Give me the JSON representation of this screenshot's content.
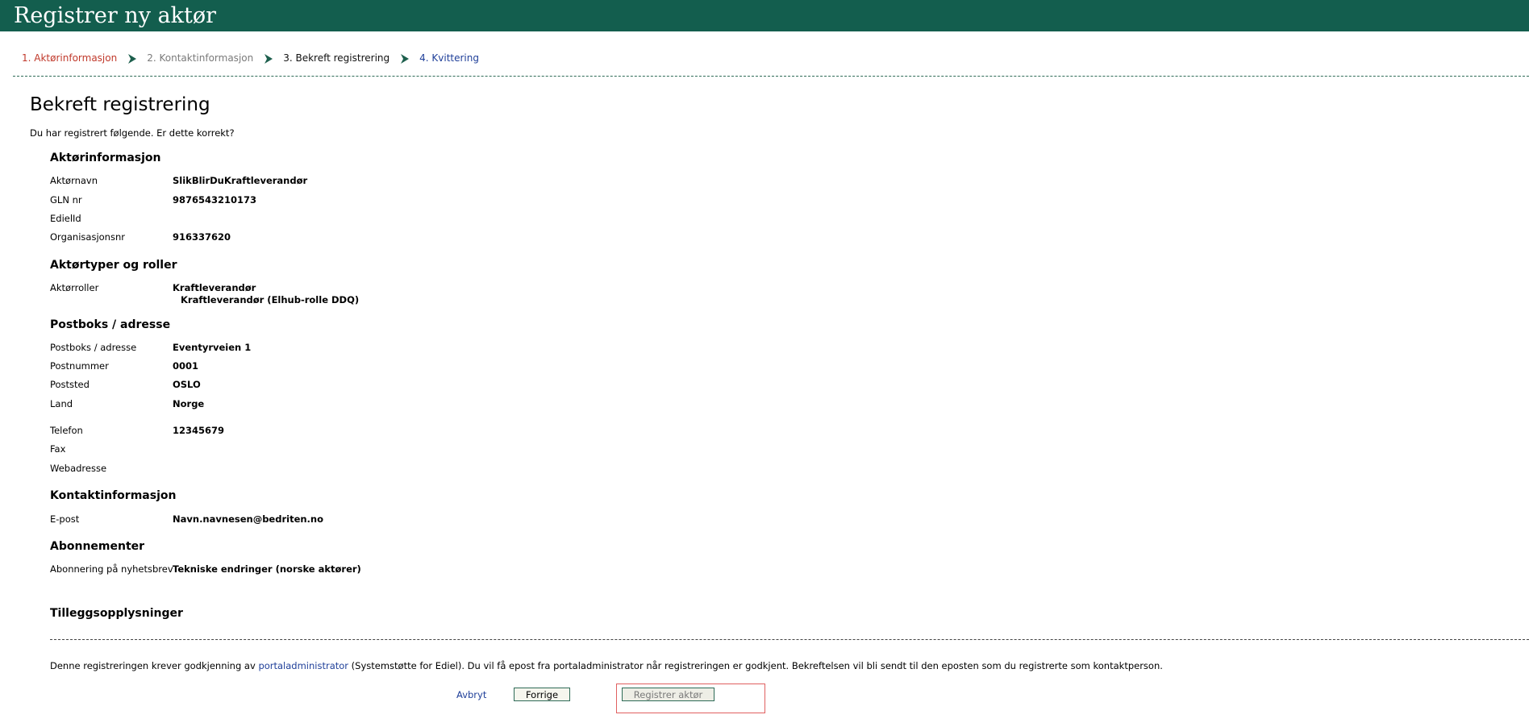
{
  "header": {
    "title": "Registrer ny aktør"
  },
  "steps": [
    {
      "label": "1. Aktørinformasjon"
    },
    {
      "label": "2. Kontaktinformasjon"
    },
    {
      "label": "3. Bekreft registrering"
    },
    {
      "label": "4. Kvittering"
    }
  ],
  "page": {
    "title": "Bekreft registrering",
    "intro": "Du har registrert følgende. Er dette korrekt?"
  },
  "actor_info": {
    "heading": "Aktørinformasjon",
    "name_label": "Aktørnavn",
    "name_value": "SlikBlirDuKraftleverandør",
    "gln_label": "GLN nr",
    "gln_value": "9876543210173",
    "ediel_label": "EdielId",
    "ediel_value": "",
    "org_label": "Organisasjonsnr",
    "org_value": "916337620"
  },
  "roles": {
    "heading": "Aktørtyper og roller",
    "roles_label": "Aktørroller",
    "role_1": "Kraftleverandør",
    "role_2": "Kraftleverandør (Elhub-rolle DDQ)"
  },
  "address": {
    "heading": "Postboks / adresse",
    "addr_label": "Postboks / adresse",
    "addr_value": "Eventyrveien 1",
    "zip_label": "Postnummer",
    "zip_value": "0001",
    "city_label": "Poststed",
    "city_value": "OSLO",
    "country_label": "Land",
    "country_value": "Norge",
    "phone_label": "Telefon",
    "phone_value": "12345679",
    "fax_label": "Fax",
    "fax_value": "",
    "web_label": "Webadresse",
    "web_value": ""
  },
  "contact": {
    "heading": "Kontaktinformasjon",
    "email_label": "E-post",
    "email_value": "Navn.navnesen@bedriten.no"
  },
  "subscriptions": {
    "heading": "Abonnementer",
    "newsletter_label": "Abonnering på nyhetsbrev",
    "newsletter_value": "Tekniske endringer (norske aktører)"
  },
  "additional": {
    "heading": "Tilleggsopplysninger"
  },
  "notice": {
    "before": "Denne registreringen krever godkjenning av ",
    "link": "portaladministrator",
    "after": " (Systemstøtte for Ediel). Du vil få epost fra portaladministrator når registreringen er godkjent. Bekreftelsen vil bli sendt til den eposten som du registrerte som kontaktperson."
  },
  "actions": {
    "cancel": "Avbryt",
    "previous": "Forrige",
    "register": "Registrer aktør"
  },
  "colors": {
    "header_bg": "#135e4e",
    "active_step": "#c0392b",
    "link": "#1f3f99"
  }
}
